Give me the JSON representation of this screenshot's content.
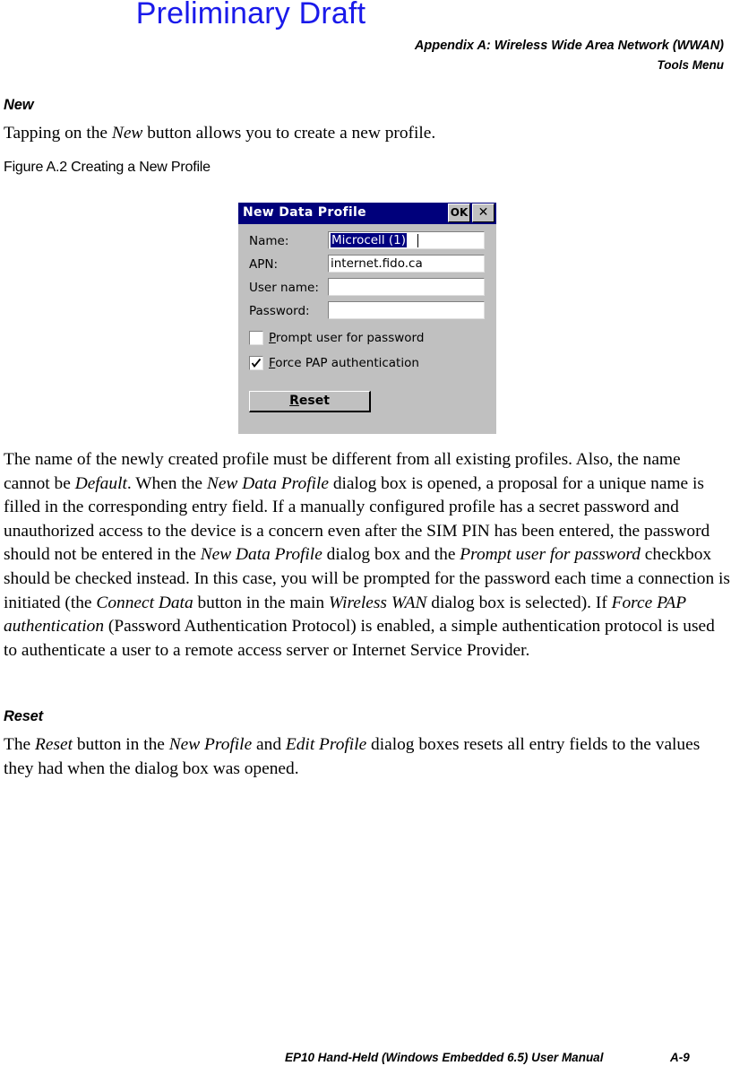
{
  "watermark": {
    "text": "Preliminary Draft",
    "color": "#1a1aea"
  },
  "header": {
    "line1": "Appendix A:  Wireless Wide Area Network (WWAN)",
    "line2": "Tools Menu"
  },
  "sections": {
    "new": {
      "heading": "New",
      "intro_before": "Tapping on the ",
      "intro_italic": "New",
      "intro_after": " button allows you to create a new profile."
    },
    "reset": {
      "heading": "Reset"
    }
  },
  "figure": {
    "caption": "Figure A.2  Creating a New Profile"
  },
  "dialog": {
    "title": "New Data Profile",
    "titlebar_color": "#00007b",
    "face_color": "#c0c0c0",
    "selection_color": "#000080",
    "ok_button": "OK",
    "close_button": "✕",
    "fields": [
      {
        "label": "Name:",
        "value": "Microcell (1)",
        "selected": true
      },
      {
        "label": "APN:",
        "value": "internet.fido.ca",
        "selected": false
      },
      {
        "label": "User name:",
        "value": "",
        "selected": false
      },
      {
        "label": "Password:",
        "value": "",
        "selected": false
      }
    ],
    "checkboxes": [
      {
        "accel": "P",
        "rest": "rompt user for password",
        "checked": false
      },
      {
        "accel": "F",
        "rest": "orce PAP authentication",
        "checked": true
      }
    ],
    "reset_button": {
      "accel": "R",
      "rest": "eset"
    }
  },
  "paragraphs": {
    "p1": [
      {
        "t": "The name of the newly created profile must be different from all existing profiles. Also, the name cannot be ",
        "i": false
      },
      {
        "t": "Default",
        "i": true
      },
      {
        "t": ". When the ",
        "i": false
      },
      {
        "t": "New Data Profile",
        "i": true
      },
      {
        "t": " dialog box is opened, a proposal for a unique name is filled in the corresponding entry field. If a manually configured profile has a secret password and unauthorized access to the device is a concern even after the SIM PIN has been entered, the password should not be entered in the ",
        "i": false
      },
      {
        "t": "New Data Profile",
        "i": true
      },
      {
        "t": " dialog box and the ",
        "i": false
      },
      {
        "t": "Prompt user for password",
        "i": true
      },
      {
        "t": " checkbox should be checked instead. In this case, you will be prompted for the password each time a connection is initiated (the ",
        "i": false
      },
      {
        "t": "Connect Data",
        "i": true
      },
      {
        "t": " button in the main ",
        "i": false
      },
      {
        "t": "Wireless WAN",
        "i": true
      },
      {
        "t": " dialog box is selected). If ",
        "i": false
      },
      {
        "t": "Force PAP authentication",
        "i": true
      },
      {
        "t": " (Password Authentication Protocol) is enabled, a simple authentication protocol is used to authenticate a user to a remote access server or Internet Service Provider.",
        "i": false
      }
    ],
    "p2": [
      {
        "t": "The ",
        "i": false
      },
      {
        "t": "Reset",
        "i": true
      },
      {
        "t": " button in the ",
        "i": false
      },
      {
        "t": "New Profile",
        "i": true
      },
      {
        "t": " and ",
        "i": false
      },
      {
        "t": "Edit Profile",
        "i": true
      },
      {
        "t": " dialog boxes resets all entry fields to the values they had when the dialog box was opened.",
        "i": false
      }
    ]
  },
  "footer": {
    "title": "EP10 Hand-Held (Windows Embedded 6.5) User Manual",
    "page": "A-9"
  }
}
